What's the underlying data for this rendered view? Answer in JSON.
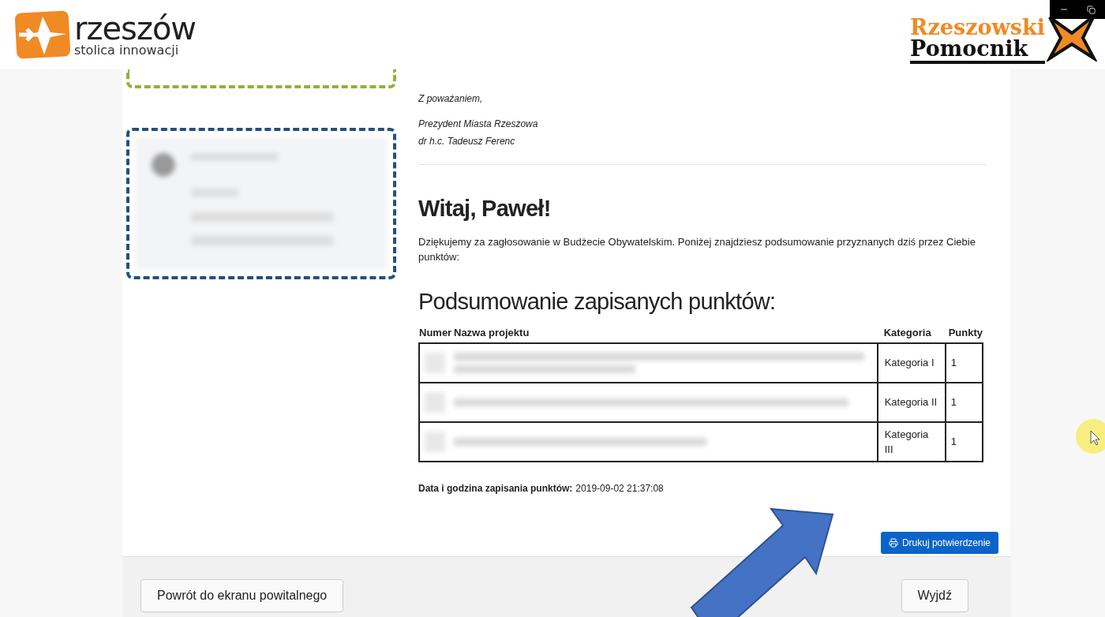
{
  "logos": {
    "left": {
      "name": "rzeszów",
      "tagline": "stolica innowacji"
    },
    "right": {
      "line_1": "Rzeszowski",
      "line_2": "Pomocnik"
    }
  },
  "letter": {
    "closing": "Z poważaniem,",
    "signature": [
      "Prezydent Miasta Rzeszowa",
      "dr h.c. Tadeusz Ferenc"
    ]
  },
  "greeting": "Witaj, Paweł!",
  "message": "Dziękujemy za zagłosowanie w Budżecie Obywatelskim. Poniżej znajdziesz podsumowanie przyznanych dziś przez Ciebie punktów:",
  "summary_title": "Podsumowanie zapisanych punktów:",
  "table": {
    "columns": [
      "Numer",
      "Nazwa projektu",
      "Kategoria",
      "Punkty"
    ],
    "rows": [
      {
        "category": "Kategoria I",
        "points": "1"
      },
      {
        "category": "Kategoria II",
        "points": "1"
      },
      {
        "category": "Kategoria III",
        "points": "1"
      }
    ]
  },
  "saved_at": {
    "label": "Data i godzina zapisania punktów:",
    "value": "2019-09-02 21:37:08"
  },
  "print_button": "Drukuj potwierdzenie",
  "footer": {
    "back_button": "Powrót do ekranu powitalnego",
    "exit_button": "Wyjdź"
  }
}
